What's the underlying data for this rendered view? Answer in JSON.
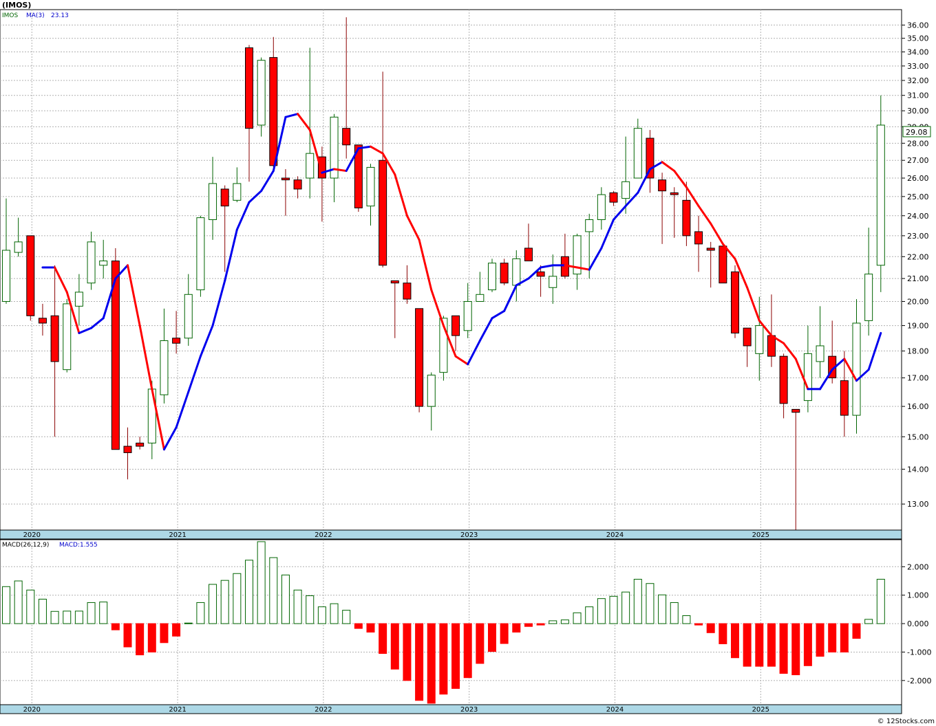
{
  "title": "(IMOS)",
  "legend": {
    "symbol": "IMOS",
    "ma_label": "MA(3)",
    "ma_value": "23.13",
    "macd_label": "MACD(26,12,9)",
    "macd_value": "MACD:1.555"
  },
  "price_badge": "29.08",
  "footer": "© 12Stocks.com",
  "colors": {
    "up": "#ffffff",
    "down": "#ff0000",
    "wick_up": "#006400",
    "ma_up": "#0000ee",
    "ma_down": "#ff0000",
    "axis_band": "#add8e6",
    "grid": "#b0b0b0",
    "badge_border": "#006400"
  },
  "chart_data": [
    {
      "type": "candlestick",
      "title": "(IMOS)",
      "scale": "log",
      "ylim": [
        12.3,
        37.2
      ],
      "y_ticks": [
        "13.00",
        "14.00",
        "15.00",
        "16.00",
        "17.00",
        "18.00",
        "19.00",
        "20.00",
        "21.00",
        "22.00",
        "23.00",
        "24.00",
        "25.00",
        "26.00",
        "27.00",
        "28.00",
        "29.00",
        "30.00",
        "31.00",
        "32.00",
        "33.00",
        "34.00",
        "35.00",
        "36.00"
      ],
      "x_labels": [
        "2020",
        "2021",
        "2022",
        "2023",
        "2024",
        "2025"
      ],
      "series": [
        {
          "name": "IMOS",
          "ohlc": [
            [
              20.0,
              24.9,
              19.9,
              22.3
            ],
            [
              22.2,
              23.9,
              22.0,
              22.7
            ],
            [
              23.0,
              23.0,
              19.2,
              19.4
            ],
            [
              19.3,
              19.9,
              18.6,
              19.1
            ],
            [
              19.4,
              21.6,
              15.0,
              17.6
            ],
            [
              17.3,
              20.1,
              17.2,
              19.9
            ],
            [
              19.8,
              21.2,
              19.0,
              20.4
            ],
            [
              20.8,
              23.2,
              20.5,
              22.7
            ],
            [
              21.6,
              22.8,
              21.0,
              21.8
            ],
            [
              21.8,
              22.4,
              14.7,
              14.6
            ],
            [
              14.7,
              15.3,
              13.7,
              14.5
            ],
            [
              14.8,
              15.0,
              14.6,
              14.7
            ],
            [
              14.8,
              16.9,
              14.3,
              16.6
            ],
            [
              16.4,
              19.7,
              16.1,
              18.4
            ],
            [
              18.5,
              19.6,
              17.9,
              18.3
            ],
            [
              18.5,
              21.2,
              18.2,
              20.3
            ],
            [
              20.5,
              24.0,
              20.2,
              23.9
            ],
            [
              23.8,
              27.2,
              22.8,
              25.7
            ],
            [
              25.4,
              25.6,
              21.3,
              24.5
            ],
            [
              24.8,
              26.6,
              24.7,
              25.7
            ],
            [
              34.3,
              34.5,
              25.8,
              28.9
            ],
            [
              29.1,
              33.6,
              28.4,
              33.4
            ],
            [
              33.6,
              35.1,
              26.6,
              26.7
            ],
            [
              26.0,
              26.5,
              24.0,
              25.9
            ],
            [
              25.9,
              26.1,
              24.9,
              25.4
            ],
            [
              26.0,
              34.3,
              24.9,
              27.4
            ],
            [
              27.2,
              27.8,
              23.7,
              26.0
            ],
            [
              26.0,
              29.8,
              24.7,
              29.6
            ],
            [
              28.9,
              36.6,
              27.1,
              27.9
            ],
            [
              27.9,
              27.9,
              24.2,
              24.4
            ],
            [
              24.5,
              26.8,
              23.5,
              26.6
            ],
            [
              27.0,
              32.6,
              21.5,
              21.6
            ],
            [
              20.9,
              20.9,
              18.5,
              20.8
            ],
            [
              20.8,
              21.6,
              19.9,
              20.1
            ],
            [
              19.7,
              19.7,
              15.8,
              16.0
            ],
            [
              16.0,
              17.2,
              15.2,
              17.1
            ],
            [
              17.2,
              19.4,
              16.9,
              19.3
            ],
            [
              19.4,
              19.4,
              18.0,
              18.6
            ],
            [
              18.8,
              20.8,
              18.5,
              20.0
            ],
            [
              20.0,
              21.3,
              20.0,
              20.3
            ],
            [
              20.5,
              21.9,
              20.4,
              21.7
            ],
            [
              21.7,
              21.9,
              20.7,
              20.8
            ],
            [
              20.7,
              22.3,
              20.0,
              21.9
            ],
            [
              22.4,
              23.6,
              21.8,
              21.8
            ],
            [
              21.3,
              21.6,
              20.2,
              21.1
            ],
            [
              20.6,
              22.1,
              19.9,
              21.1
            ],
            [
              22.0,
              23.1,
              21.0,
              21.1
            ],
            [
              21.2,
              23.1,
              20.5,
              23.0
            ],
            [
              23.2,
              24.1,
              21.0,
              23.8
            ],
            [
              23.8,
              25.5,
              23.3,
              25.1
            ],
            [
              25.2,
              25.3,
              24.5,
              24.7
            ],
            [
              24.9,
              28.4,
              24.1,
              25.8
            ],
            [
              26.0,
              29.5,
              26.0,
              28.9
            ],
            [
              28.3,
              28.8,
              25.2,
              26.0
            ],
            [
              25.9,
              26.3,
              22.6,
              25.3
            ],
            [
              25.2,
              25.5,
              22.9,
              25.1
            ],
            [
              24.8,
              25.8,
              22.5,
              23.0
            ],
            [
              23.2,
              24.0,
              21.3,
              22.6
            ],
            [
              22.4,
              22.7,
              20.6,
              22.3
            ],
            [
              22.5,
              22.5,
              20.8,
              20.8
            ],
            [
              21.3,
              21.6,
              18.5,
              18.7
            ],
            [
              18.9,
              18.9,
              17.4,
              18.2
            ],
            [
              17.9,
              20.2,
              16.9,
              19.0
            ],
            [
              18.6,
              20.3,
              17.4,
              17.8
            ],
            [
              17.8,
              17.9,
              15.6,
              16.1
            ],
            [
              15.9,
              15.9,
              12.3,
              15.8
            ],
            [
              16.2,
              19.0,
              15.8,
              17.9
            ],
            [
              17.6,
              19.8,
              17.0,
              18.2
            ],
            [
              17.8,
              19.2,
              16.8,
              17.0
            ],
            [
              16.9,
              18.0,
              15.0,
              15.7
            ],
            [
              15.7,
              20.1,
              15.1,
              19.1
            ],
            [
              19.2,
              23.4,
              18.6,
              21.2
            ],
            [
              21.6,
              31.0,
              20.4,
              29.1
            ]
          ]
        },
        {
          "name": "MA(3)",
          "values": [
            null,
            null,
            null,
            21.5,
            21.5,
            20.4,
            18.7,
            18.9,
            19.3,
            21.0,
            21.6,
            19.0,
            16.6,
            14.6,
            15.3,
            16.5,
            17.8,
            19.0,
            20.9,
            23.3,
            24.7,
            25.3,
            26.4,
            29.6,
            29.8,
            28.8,
            26.3,
            26.5,
            26.4,
            27.7,
            27.8,
            27.4,
            26.2,
            24.0,
            22.8,
            20.5,
            19.0,
            17.8,
            17.5,
            18.4,
            19.3,
            19.6,
            20.7,
            21.0,
            21.5,
            21.6,
            21.6,
            21.5,
            21.4,
            22.4,
            23.8,
            24.5,
            25.2,
            26.5,
            26.9,
            26.4,
            25.5,
            24.5,
            23.6,
            22.6,
            21.9,
            20.6,
            19.2,
            18.6,
            18.3,
            17.7,
            16.6,
            16.6,
            17.3,
            17.7,
            16.9,
            17.3,
            18.7,
            23.1
          ]
        }
      ]
    },
    {
      "type": "bar",
      "title": "MACD(26,12,9)",
      "ylim": [
        -2.85,
        2.95
      ],
      "y_ticks": [
        "-2.000",
        "-1.000",
        "0.000",
        "1.000",
        "2.000"
      ],
      "x_labels": [
        "2020",
        "2021",
        "2022",
        "2023",
        "2024",
        "2025"
      ],
      "series": [
        {
          "name": "MACD",
          "values": [
            1.3,
            1.5,
            1.18,
            0.86,
            0.43,
            0.44,
            0.44,
            0.74,
            0.76,
            -0.22,
            -0.82,
            -1.1,
            -1.0,
            -0.67,
            -0.44,
            0.02,
            0.74,
            1.38,
            1.52,
            1.76,
            2.23,
            2.88,
            2.32,
            1.71,
            1.18,
            0.98,
            0.59,
            0.7,
            0.47,
            -0.17,
            -0.3,
            -1.05,
            -1.6,
            -2.0,
            -2.7,
            -2.8,
            -2.48,
            -2.28,
            -1.9,
            -1.4,
            -0.98,
            -0.7,
            -0.3,
            -0.1,
            -0.05,
            0.1,
            0.13,
            0.38,
            0.59,
            0.88,
            0.96,
            1.11,
            1.56,
            1.41,
            1.01,
            0.74,
            0.28,
            -0.05,
            -0.32,
            -0.71,
            -1.2,
            -1.5,
            -1.5,
            -1.5,
            -1.75,
            -1.8,
            -1.48,
            -1.15,
            -1.0,
            -1.0,
            -0.52,
            0.15,
            1.56
          ]
        }
      ]
    }
  ]
}
